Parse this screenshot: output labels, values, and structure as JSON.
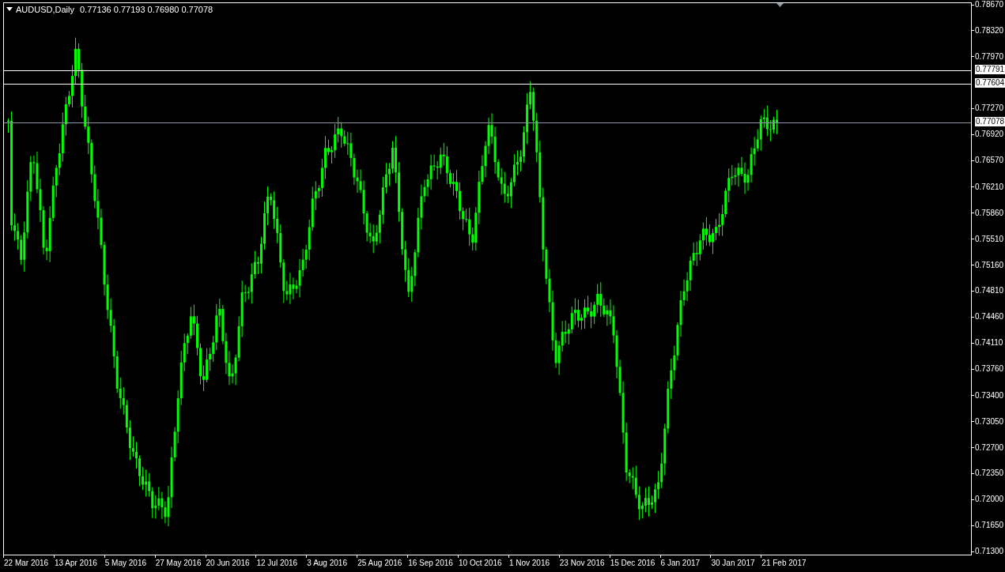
{
  "header": {
    "symbol": "AUDUSD,Daily",
    "quotes": "0.77136 0.77193 0.76980 0.77078"
  },
  "price_axis": [
    "0.78670",
    "0.78320",
    "0.77970",
    "0.77270",
    "0.76920",
    "0.76570",
    "0.76210",
    "0.75860",
    "0.75510",
    "0.75160",
    "0.74810",
    "0.74460",
    "0.74110",
    "0.73760",
    "0.73400",
    "0.73050",
    "0.72700",
    "0.72350",
    "0.72000",
    "0.71650",
    "0.71300"
  ],
  "levels": [
    {
      "price": "0.77791",
      "color": "#ffffff"
    },
    {
      "price": "0.77604",
      "color": "#ffffff"
    },
    {
      "price": "0.77078",
      "color": "#8c96a0"
    }
  ],
  "time_axis": [
    "22 Mar 2016",
    "13 Apr 2016",
    "5 May 2016",
    "27 May 2016",
    "20 Jun 2016",
    "12 Jul 2016",
    "3 Aug 2016",
    "25 Aug 2016",
    "16 Sep 2016",
    "10 Oct 2016",
    "1 Nov 2016",
    "23 Nov 2016",
    "15 Dec 2016",
    "6 Jan 2017",
    "30 Jan 2017",
    "21 Feb 2017"
  ]
}
